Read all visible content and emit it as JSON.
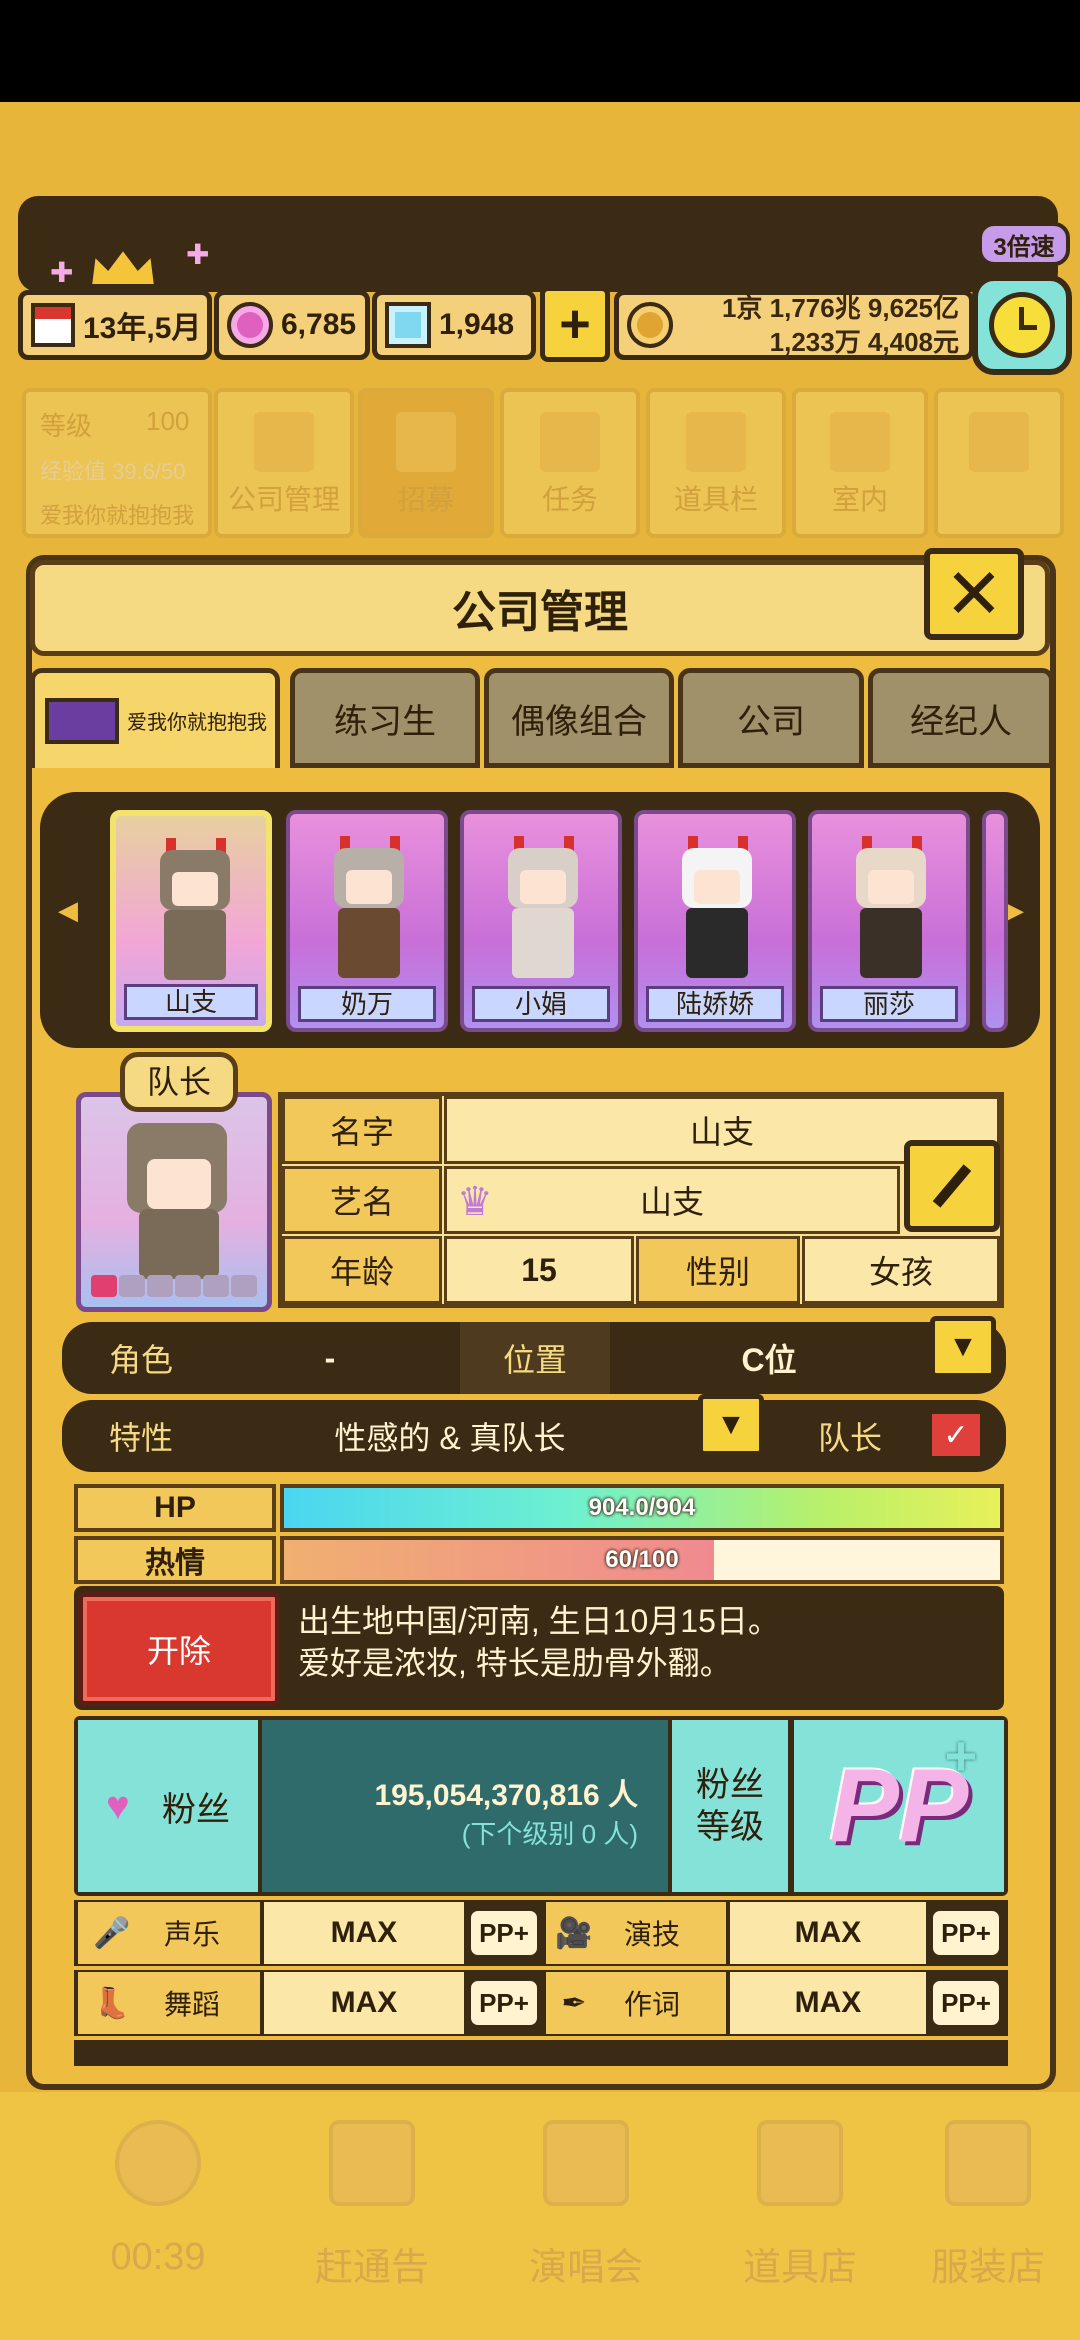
{
  "hud": {
    "date": "13年,5月",
    "gems": "6,785",
    "diamonds": "1,948",
    "plus": "+",
    "money_line1": "1京 1,776兆 9,625亿",
    "money_line2": "1,233万 4,408元",
    "speed": "3倍速"
  },
  "bg_menu": {
    "level_label": "等级",
    "level_value": "100",
    "exp_label": "经验值 39.6/50",
    "group_name": "爱我你就抱抱我",
    "items": [
      "公司管理",
      "招募",
      "任务",
      "道具栏",
      "室内"
    ]
  },
  "panel": {
    "title": "公司管理",
    "close": "✕"
  },
  "tabs": {
    "group": "爱我你就抱抱我",
    "items": [
      "练习生",
      "偶像组合",
      "公司",
      "经纪人"
    ]
  },
  "roster": [
    {
      "name": "山支"
    },
    {
      "name": "奶万"
    },
    {
      "name": "小娟"
    },
    {
      "name": "陆娇娇"
    },
    {
      "name": "丽莎"
    }
  ],
  "member": {
    "badge": "队长",
    "name_label": "名字",
    "name": "山支",
    "stage_label": "艺名",
    "stage_name": "山支",
    "age_label": "年龄",
    "age": "15",
    "gender_label": "性别",
    "gender": "女孩",
    "role_label": "角色",
    "role": "-",
    "position_label": "位置",
    "position": "C位",
    "trait_label": "特性",
    "trait": "性感的 & 真队长",
    "leader_label": "队长"
  },
  "bars": {
    "hp_label": "HP",
    "hp_text": "904.0/904",
    "hp_fraction": 1.0,
    "passion_label": "热情",
    "passion_text": "60/100",
    "passion_fraction": 0.6
  },
  "bio": {
    "fire": "开除",
    "line1": "出生地中国/河南, 生日10月15日。",
    "line2": "爱好是浓妆, 特长是肋骨外翻。"
  },
  "fans": {
    "label": "粉丝",
    "count": "195,054,370,816 人",
    "next": "(下个级别 0 人)",
    "level_label_1": "粉丝",
    "level_label_2": "等级",
    "pp": "PP",
    "pp_plus": "+"
  },
  "skills": [
    {
      "icon": "microphone-icon",
      "label": "声乐",
      "value": "MAX",
      "tag": "PP+"
    },
    {
      "icon": "camera-icon",
      "label": "演技",
      "value": "MAX",
      "tag": "PP+"
    },
    {
      "icon": "shoe-icon",
      "label": "舞蹈",
      "value": "MAX",
      "tag": "PP+"
    },
    {
      "icon": "pen-icon",
      "label": "作词",
      "value": "MAX",
      "tag": "PP+"
    }
  ],
  "bottom_nav": {
    "timer": "00:39",
    "items": [
      "赶通告",
      "演唱会",
      "道具店",
      "服装店"
    ]
  },
  "colors": {
    "background": "#e7b53a",
    "dark": "#3b2a14",
    "accent_teal": "#84e2d8",
    "fire_red": "#d8382e"
  }
}
